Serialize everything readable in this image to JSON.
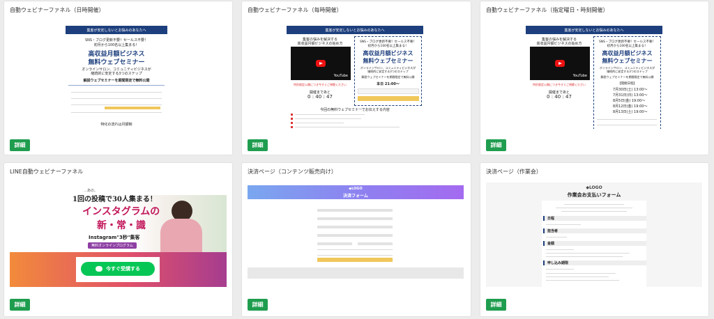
{
  "cards": [
    {
      "title": "自動ウェビナーファネル（日時開催）",
      "button": "詳細"
    },
    {
      "title": "自動ウェビナーファネル（毎時開催）",
      "button": "詳細"
    },
    {
      "title": "自動ウェビナーファネル（指定曜日・時刻開催）",
      "button": "詳細"
    },
    {
      "title": "LINE自動ウェビナーファネル",
      "button": "詳細"
    },
    {
      "title": "決済ページ（コンテンツ販売向け）",
      "button": "詳細"
    },
    {
      "title": "決済ページ（作業会）",
      "button": "詳細"
    }
  ],
  "webinar": {
    "banner": "集客が安定しないとお悩みのあなたへ",
    "line1": "SNS・ブログ更新不要！セールス不要！",
    "line2": "初月から100名以上集まる！",
    "headline1": "高収益月額ビジネス",
    "headline2": "無料ウェブセミナー",
    "sub1": "オンラインサロン、コミュニティビジネスが",
    "sub2": "継続的に安定する3つのステップ",
    "cta": "解説ウェブセミナーを期間限定で無料公開",
    "footer": "特化の流れは月額制",
    "left_top1": "集客の悩みを解決する",
    "left_top2": "高収益月額ビジネスの始め方",
    "youtube": "YouTube",
    "notice": "特別限定公開につき今すぐご視聴ください",
    "countdown_label": "開催まであと",
    "countdown": "0 : 40 : 47",
    "time_label": "本日 21:00～",
    "list_title": "今回の無料ウェブセミナーでお伝えする内容",
    "schedule_title": "【開催日程】",
    "schedule": [
      "7月30日(土) 13:00～",
      "7月31日(日) 13:00～",
      "8月5日(金) 19:00～",
      "8月12日(金) 19:00～",
      "8月13日(土) 19:00～"
    ]
  },
  "line_funnel": {
    "small": "…あの、",
    "catch": "1回の投稿で30人集まる！",
    "big1": "インスタグラムの",
    "big2": "新・常・識",
    "sub": "Instagram\"3秒\"集客",
    "badge": "無料オンラインプログラム",
    "cta": "今すぐ受講する"
  },
  "payment": {
    "logo": "LOGO",
    "title": "決済フォーム",
    "button": "お支払いを確定する"
  },
  "work_payment": {
    "logo": "LOGO",
    "title": "作業会お支払いフォーム",
    "sections": [
      "日程",
      "担当者",
      "金額",
      "申し込み期限"
    ]
  },
  "colors": {
    "button": "#1f9d4f",
    "navy": "#1d3f7d",
    "line_green": "#06c755"
  }
}
